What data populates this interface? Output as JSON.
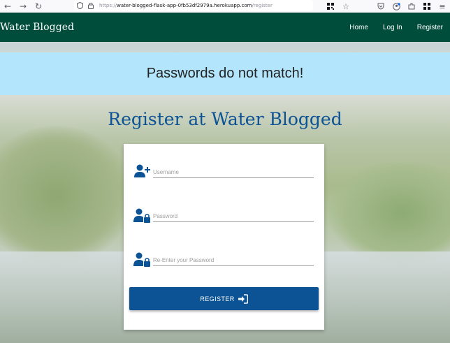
{
  "browser": {
    "url_prefix": "https://",
    "url_host": "water-blogged-flask-app-0fb53df2979a.herokuapp.com",
    "url_path": "/register"
  },
  "navbar": {
    "brand": "Water Blogged",
    "links": [
      {
        "label": "Home"
      },
      {
        "label": "Log In"
      },
      {
        "label": "Register"
      }
    ]
  },
  "flash": {
    "message": "Passwords do not match!",
    "color": "#b3e5fc"
  },
  "page": {
    "title": "Register at Water Blogged"
  },
  "form": {
    "username": {
      "placeholder": "Username",
      "value": ""
    },
    "password": {
      "placeholder": "Password",
      "value": ""
    },
    "password_confirm": {
      "placeholder": "Re-Enter your Password",
      "value": ""
    },
    "submit_label": "REGISTER"
  },
  "colors": {
    "navbar": "#004d3c",
    "accent": "#0b5394"
  }
}
